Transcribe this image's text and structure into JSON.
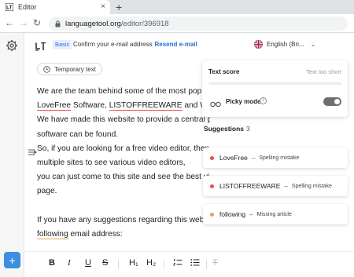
{
  "browser": {
    "tab_title": "Editor",
    "tab_close": "×",
    "new_tab": "+",
    "url_host": "languagetool.org",
    "url_path": "/editor/396918",
    "back": "←",
    "forward": "→",
    "reload": "↻"
  },
  "topbar": {
    "badge": "Basic",
    "confirm_text": "Confirm your e-mail address",
    "resend_link": "Resend e-mail",
    "language": "English (Bri...",
    "lang_chevron": "⌄"
  },
  "editor": {
    "temp_chip": "Temporary text",
    "lines": [
      [
        {
          "t": "We are the team behind some of the most popula"
        }
      ],
      [
        {
          "t": "LoveFree",
          "e": "red"
        },
        {
          "t": " Software, "
        },
        {
          "t": "LISTOFFREEWARE",
          "e": "red"
        },
        {
          "t": " and Windo"
        }
      ],
      [
        {
          "t": "We have made this website to provide a central place w"
        }
      ],
      [
        {
          "t": "software can be found."
        }
      ],
      [
        {
          "t": "So, if you are looking for a free video editor, then "
        }
      ],
      [
        {
          "t": "multiple sites to see various video editors,"
        }
      ],
      [
        {
          "t": "you can just come to this site and see the best vid"
        }
      ],
      [
        {
          "t": "page."
        }
      ],
      [],
      [
        {
          "t": "If you have any suggestions regarding this websit"
        }
      ],
      [
        {
          "t": "following",
          "e": "orange"
        },
        {
          "t": " email address:"
        }
      ]
    ]
  },
  "format_toolbar": {
    "bold": "B",
    "italic": "I",
    "underline": "U",
    "strike": "S",
    "h1": "H₁",
    "h2": "H₂",
    "ol": "⅓≡",
    "ul": "≡",
    "clear": "T"
  },
  "panel": {
    "score_title": "Text score",
    "score_hint": "Text too short",
    "picky_label": "Picky mode",
    "info": "i",
    "picky_on": false
  },
  "suggestions": {
    "heading": "Suggestions",
    "count": "3",
    "items": [
      {
        "word": "LoveFree",
        "dash": "–",
        "kind": "Spelling mistake",
        "color": "#e05252"
      },
      {
        "word": "LISTOFFREEWARE",
        "dash": "–",
        "kind": "Spelling mistake",
        "color": "#e05252"
      },
      {
        "word": "following",
        "dash": "–",
        "kind": "Missing article",
        "color": "#e8a24a"
      }
    ]
  },
  "sidebar": {
    "plus": "+"
  },
  "colors": {
    "accent": "#3d8fe0",
    "error": "#e05252",
    "style": "#e8a24a"
  }
}
